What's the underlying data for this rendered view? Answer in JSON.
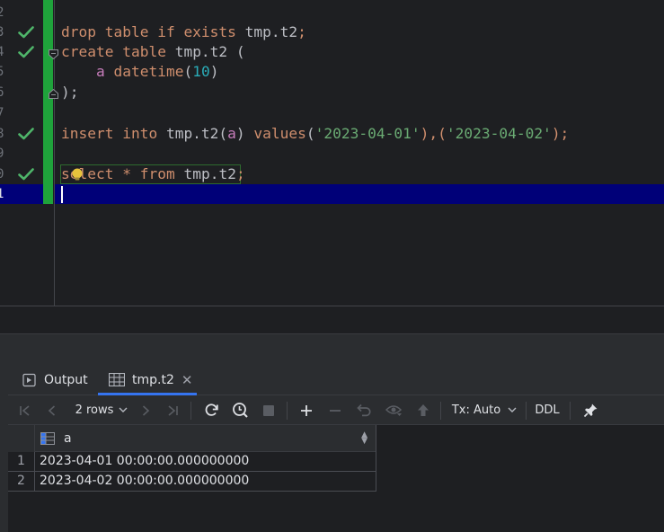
{
  "editor": {
    "gutter": [
      {
        "num": "2",
        "check": false
      },
      {
        "num": "3",
        "check": true
      },
      {
        "num": "4",
        "check": true
      },
      {
        "num": "5",
        "check": false
      },
      {
        "num": "6",
        "check": false
      },
      {
        "num": "7",
        "check": false
      },
      {
        "num": "8",
        "check": true
      },
      {
        "num": "9",
        "check": false
      },
      {
        "num": "0",
        "check": true
      },
      {
        "num": "1",
        "check": false
      }
    ],
    "lines": {
      "l3": {
        "kw1": "drop table if exists",
        "ident": " tmp.t2",
        "semi": ";"
      },
      "l4": {
        "kw1": "create table",
        "ident": " tmp.t2 ("
      },
      "l5": {
        "indent": "    ",
        "col": "a",
        "kw1": " datetime",
        "p1": "(",
        "num": "10",
        "p2": ")"
      },
      "l6": {
        "text": ");"
      },
      "l8": {
        "kw1": "insert into",
        "ident": " tmp.t2(",
        "col": "a",
        "p1": ") ",
        "kw2": "values",
        "p2": "(",
        "s1": "'2023-04-01'",
        "p3": "),(",
        "s2": "'2023-04-02'",
        "p4": ");"
      },
      "l10": {
        "kw1": "select",
        "op": " * ",
        "kw2": "from",
        "ident": " tmp.t2",
        "semi": ";"
      }
    }
  },
  "panel": {
    "tabs": [
      {
        "label": "Output",
        "icon": "console-run-icon"
      },
      {
        "label": "tmp.t2",
        "icon": "table-icon",
        "active": true
      }
    ],
    "toolbar": {
      "rows_label": "2 rows",
      "tx_label": "Tx: Auto",
      "ddl_label": "DDL"
    },
    "grid": {
      "column": "a",
      "rows": [
        {
          "num": "1",
          "value": "2023-04-01 00:00:00.000000000"
        },
        {
          "num": "2",
          "value": "2023-04-02 00:00:00.000000000"
        }
      ]
    }
  },
  "colors": {
    "keyword": "#cf8e6d",
    "string": "#6aab73",
    "number": "#2aacb8",
    "column": "#c77dbb",
    "change_bar": "#1fa33b",
    "current_line": "#000078"
  }
}
